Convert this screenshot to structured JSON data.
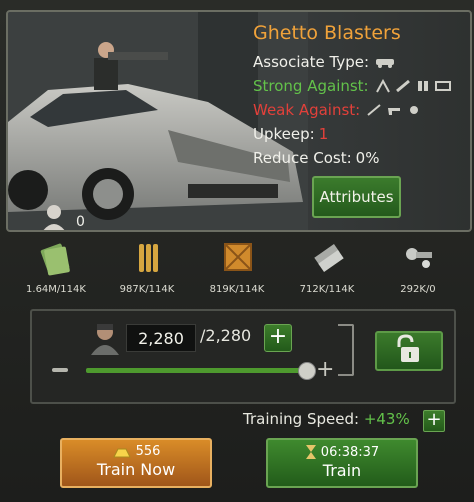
{
  "unit": {
    "name": "Ghetto Blasters",
    "associate_type_label": "Associate Type:",
    "strong_against_label": "Strong Against:",
    "weak_against_label": "Weak Against:",
    "upkeep_label": "Upkeep:",
    "upkeep_value": "1",
    "reduce_cost_label": "Reduce Cost:",
    "reduce_cost_value": "0%",
    "owned_count": "0",
    "attributes_button": "Attributes"
  },
  "resources": [
    {
      "icon": "cash-icon",
      "value": "1.64M/114K"
    },
    {
      "icon": "ammo-icon",
      "value": "987K/114K"
    },
    {
      "icon": "crate-icon",
      "value": "819K/114K"
    },
    {
      "icon": "metal-icon",
      "value": "712K/114K"
    },
    {
      "icon": "parts-icon",
      "value": "292K/0"
    }
  ],
  "training": {
    "quantity": "2,280",
    "max": "/2,280",
    "slider_fraction": 1.0,
    "speed_label": "Training Speed:",
    "speed_value": "+43%"
  },
  "buttons": {
    "train_now_cost": "556",
    "train_now_label": "Train Now",
    "train_time": "06:38:37",
    "train_label": "Train"
  },
  "colors": {
    "title": "#f0a23a",
    "strong": "#63c24a",
    "weak": "#e2403a",
    "accent_green": "#3f8a2e",
    "accent_orange": "#d98c28"
  }
}
